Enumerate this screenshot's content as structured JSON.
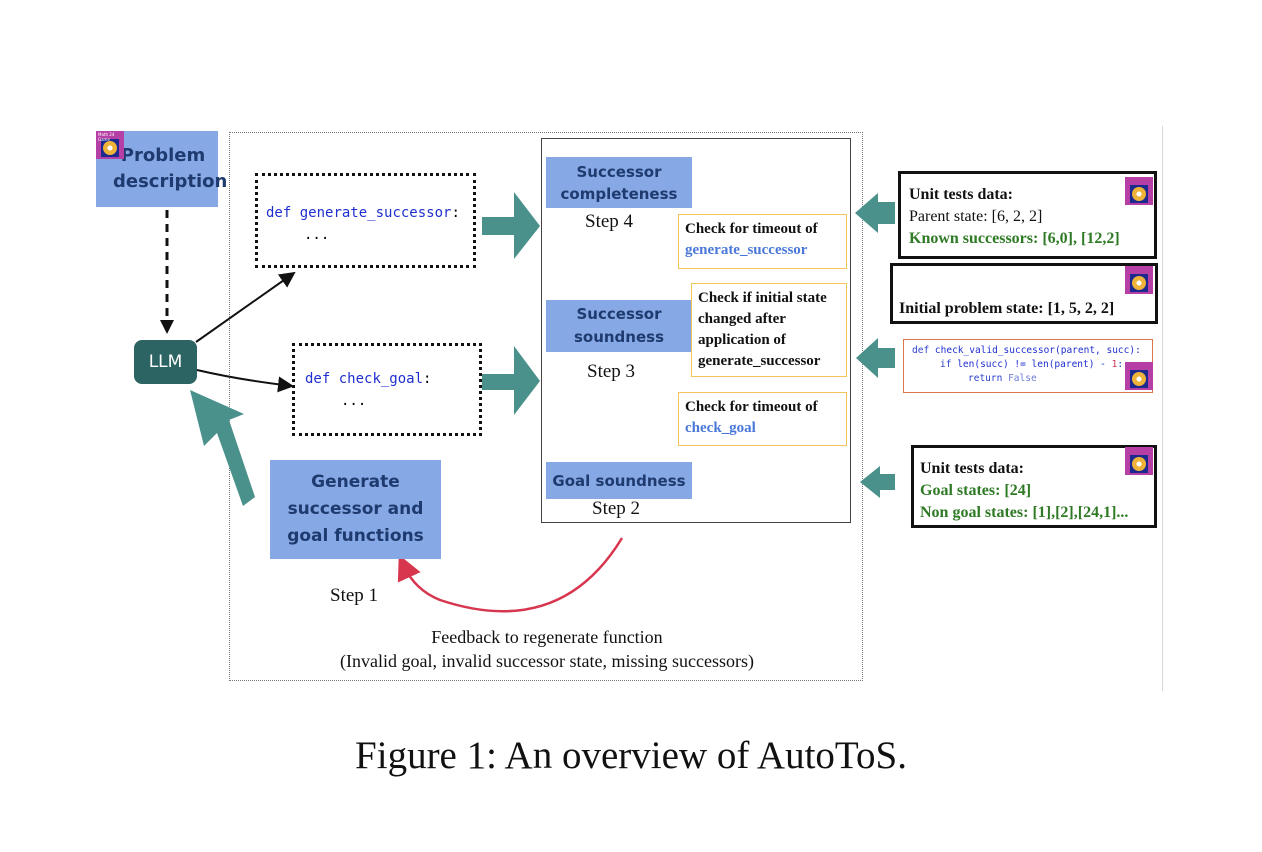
{
  "diagram": {
    "problem_description": "Problem description",
    "llm_label": "LLM",
    "generate_successor_code": {
      "kw": "def",
      "name": "generate_successor",
      "colon": ":",
      "ellipsis": "..."
    },
    "check_goal_code": {
      "kw": "def",
      "name": "check_goal",
      "colon": ":",
      "ellipsis": "..."
    },
    "generate_functions": "Generate successor and goal functions",
    "step1": "Step 1",
    "feedback_line1": "Feedback to regenerate function",
    "feedback_line2": "(Invalid goal, invalid successor state, missing successors)",
    "successor_completeness": "Successor completeness",
    "step4": "Step 4",
    "successor_soundness": "Successor soundness",
    "step3": "Step 3",
    "goal_soundness": "Goal soundness",
    "step2": "Step 2",
    "check_timeout_gen_prefix": "Check for timeout of",
    "check_timeout_gen_fn": "generate_successor",
    "check_initial_state": "Check if initial state changed after application of generate_successor",
    "check_timeout_goal_prefix": "Check for timeout of",
    "check_timeout_goal_fn": "check_goal",
    "unit_tests_successor": {
      "title": "Unit tests data:",
      "parent_state": "Parent state: [6, 2, 2]",
      "known_successors": "Known successors: [6,0], [12,2]"
    },
    "initial_problem_state": "Initial problem state: [1, 5, 2, 2]",
    "validity_code": {
      "line1_kw": "def",
      "line1_rest": "check_valid_successor(parent, succ):",
      "line2_kw": "if",
      "line2_rest": "len(succ) != len(parent) -",
      "line2_num": "1",
      "line2_end": ":",
      "line3_kw": "return",
      "line3_val": "False"
    },
    "unit_tests_goal": {
      "title": "Unit tests data:",
      "goal_states": "Goal states: [24]",
      "non_goal_states": "Non goal states: [1],[2],[24,1]..."
    },
    "badge_label": "Math 24 Game"
  },
  "caption": "Figure 1: An overview of AutoToS.",
  "colors": {
    "teal": "#4a918c",
    "blue_box": "#86a9e6",
    "dark_navy_text": "#1f3a6e",
    "feedback_red": "#d8364f",
    "gold_border": "#f2c45a",
    "green_text": "#2f7a25",
    "code_blue": "#1f2fd0"
  }
}
